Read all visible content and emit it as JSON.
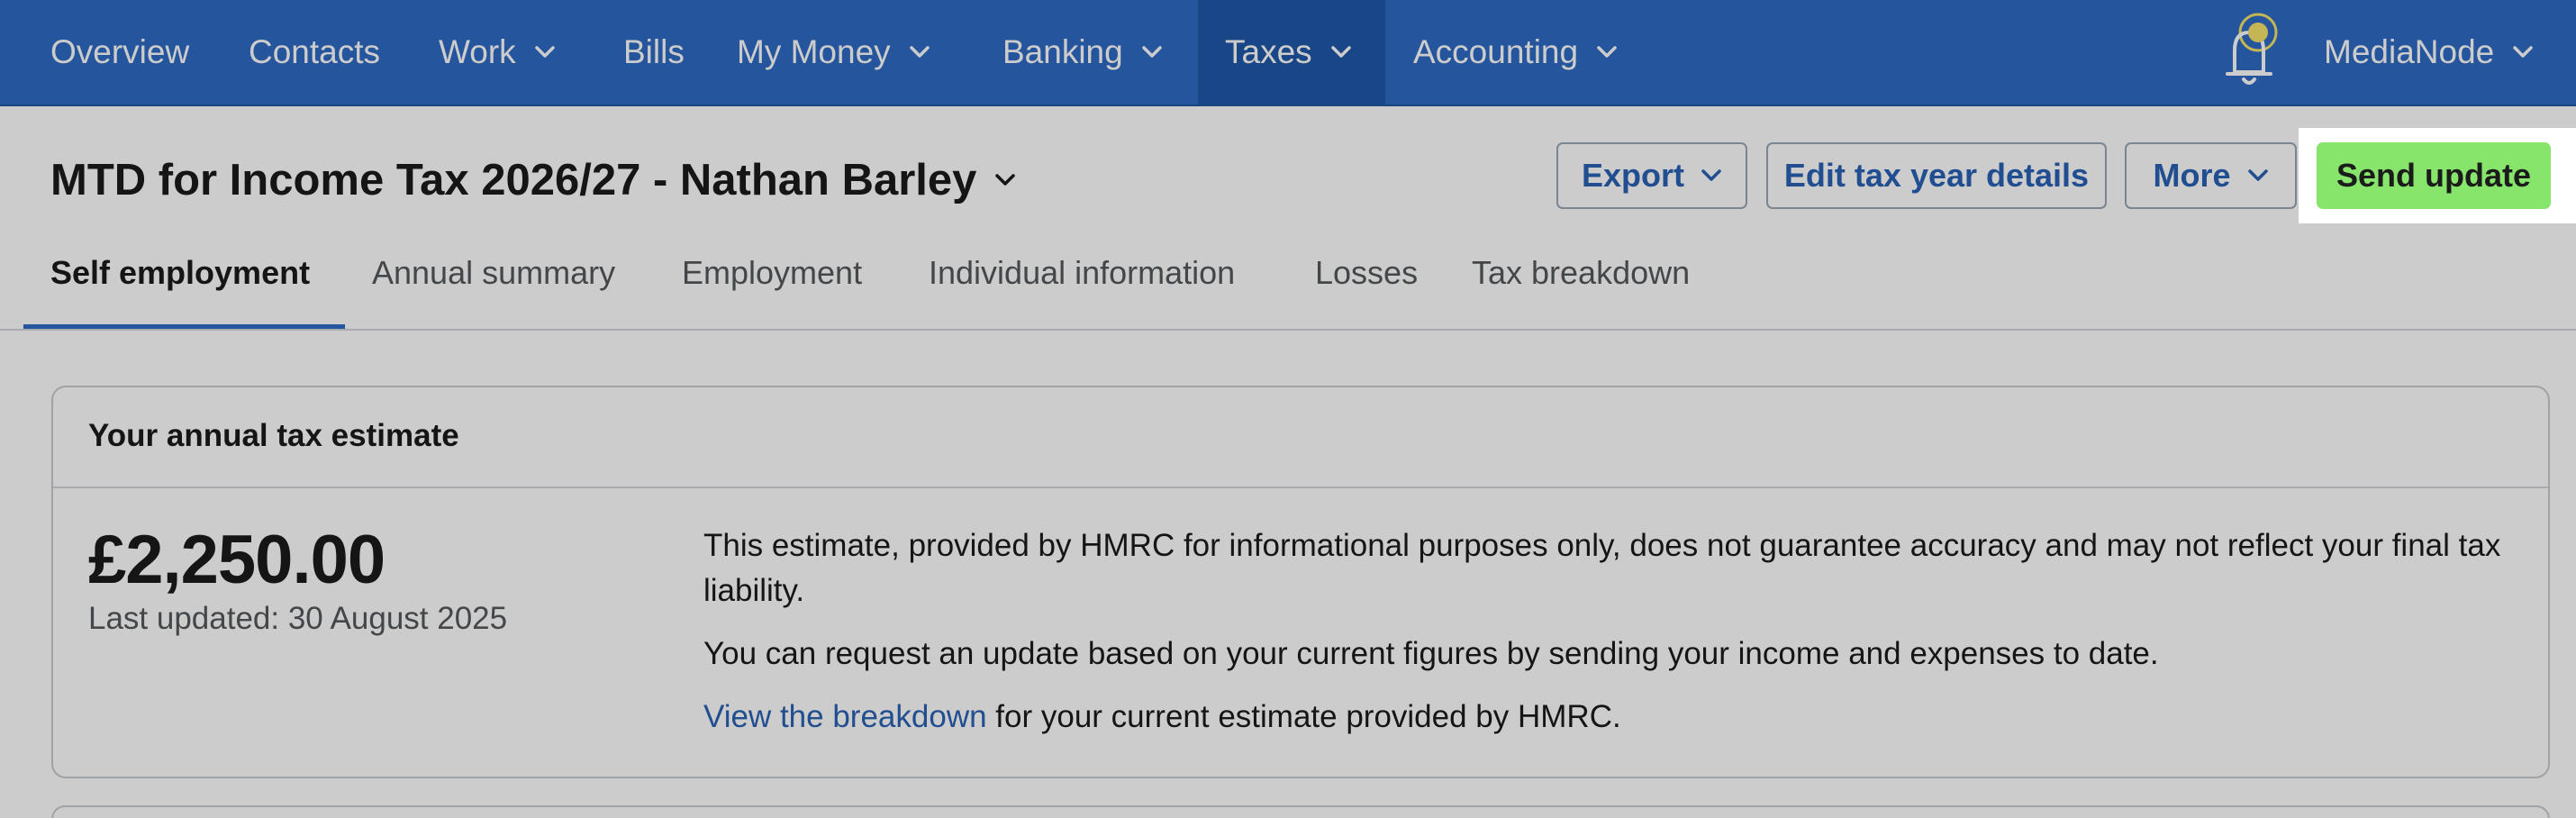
{
  "nav": {
    "items": [
      {
        "label": "Overview"
      },
      {
        "label": "Contacts"
      },
      {
        "label": "Work"
      },
      {
        "label": "Bills"
      },
      {
        "label": "My Money"
      },
      {
        "label": "Banking"
      },
      {
        "label": "Taxes"
      },
      {
        "label": "Accounting"
      }
    ],
    "account": "MediaNode"
  },
  "header": {
    "title": "MTD for Income Tax 2026/27 - Nathan Barley",
    "export_label": "Export",
    "edit_label": "Edit tax year details",
    "more_label": "More",
    "send_label": "Send update"
  },
  "tabs": [
    {
      "label": "Self employment"
    },
    {
      "label": "Annual summary"
    },
    {
      "label": "Employment"
    },
    {
      "label": "Individual information"
    },
    {
      "label": "Losses"
    },
    {
      "label": "Tax breakdown"
    }
  ],
  "estimate": {
    "title": "Your annual tax estimate",
    "amount": "£2,250.00",
    "last_updated": "Last updated: 30 August 2025",
    "para1": "This estimate, provided by HMRC for informational purposes only, does not guarantee accuracy and may not reflect your final tax liability.",
    "para2": "You can request an update based on your current figures by sending your income and expenses to date.",
    "link": "View the breakdown",
    "para3_rest": " for your current estimate provided by HMRC."
  },
  "colors": {
    "nav_bg": "#2f6bc4",
    "nav_active": "#1e58a8",
    "accent_link": "#2a62b5",
    "send_button": "#86e56a",
    "notification_dot": "#f5e46b"
  },
  "icons": {
    "bell": "bell-icon",
    "chevron": "chevron-down-icon"
  }
}
